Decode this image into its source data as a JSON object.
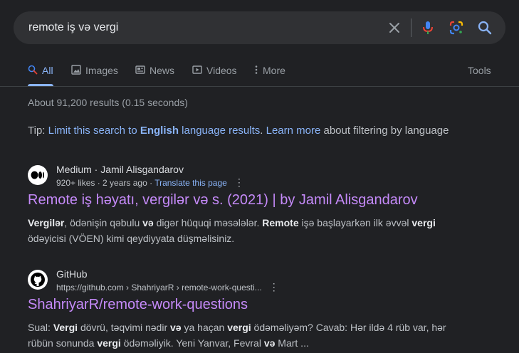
{
  "search": {
    "query": "remote iş və vergi"
  },
  "tabs": [
    {
      "label": "All"
    },
    {
      "label": "Images"
    },
    {
      "label": "News"
    },
    {
      "label": "Videos"
    },
    {
      "label": "More"
    }
  ],
  "tools_label": "Tools",
  "stats": "About 91,200 results (0.15 seconds)",
  "tip": {
    "prefix": "Tip: ",
    "limit_text": "Limit this search to ",
    "language": "English",
    "suffix_link": " language results",
    "period": ". ",
    "learn_more": "Learn more",
    "rest": " about filtering by language"
  },
  "results": [
    {
      "site": "Medium · Jamil Alisgandarov",
      "meta_likes": "920+ likes · 2 years ago · ",
      "translate": "Translate this page",
      "title": "Remote iş həyatı, vergilər və s. (2021) | by Jamil Alisgandarov",
      "snippet_parts": [
        "Vergilər",
        ", ödənişin qəbulu ",
        "və",
        " digər hüquqi məsələlər. ",
        "Remote",
        " işə başlayarkən ilk əvvəl ",
        "vergi",
        " ödəyicisi (VÖEN) kimi qeydiyyata düşməlisiniz."
      ]
    },
    {
      "site": "GitHub",
      "url": "https://github.com › ShahriyarR › remote-work-questi...",
      "title": "ShahriyarR/remote-work-questions",
      "snippet_parts": [
        "Sual: ",
        "Vergi",
        " dövrü, təqvimi nədir ",
        "və",
        " ya haçan ",
        "vergi",
        " ödəməliyəm? Cavab: Hər ildə 4 rüb var, hər rübün sonunda ",
        "vergi",
        " ödəməliyik. Yeni Yanvar, Fevral ",
        "və",
        " Mart ..."
      ]
    }
  ],
  "colors": {
    "background": "#202124",
    "link_visited": "#c58af9",
    "link": "#8ab4f8"
  }
}
